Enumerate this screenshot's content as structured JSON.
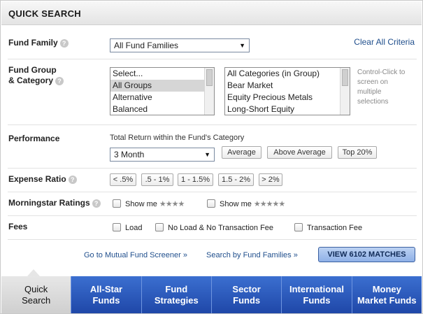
{
  "header": {
    "title": "QUICK SEARCH"
  },
  "fund_family": {
    "label": "Fund Family",
    "selected": "All Fund Families",
    "clear_link": "Clear All Criteria"
  },
  "fund_group": {
    "label_line1": "Fund Group",
    "label_line2": "& Category",
    "groups": [
      "Select...",
      "All Groups",
      "Alternative",
      "Balanced"
    ],
    "selected_group": "All Groups",
    "categories": [
      "All Categories (in Group)",
      "Bear Market",
      "Equity Precious Metals",
      "Long-Short Equity"
    ],
    "hint": "Control-Click to screen on multiple selections"
  },
  "performance": {
    "label": "Performance",
    "subtext": "Total Return within the Fund's Category",
    "selected": "3 Month",
    "buttons": [
      "Average",
      "Above Average",
      "Top 20%"
    ]
  },
  "expense_ratio": {
    "label": "Expense Ratio",
    "buttons": [
      "< .5%",
      ".5 - 1%",
      "1 - 1.5%",
      "1.5 - 2%",
      "> 2%"
    ]
  },
  "ratings": {
    "label": "Morningstar Ratings",
    "option1": {
      "text": "Show me",
      "stars": "★★★★"
    },
    "option2": {
      "text": "Show me",
      "stars": "★★★★★"
    }
  },
  "fees": {
    "label": "Fees",
    "options": [
      "Load",
      "No Load & No Transaction Fee",
      "Transaction Fee"
    ]
  },
  "footer": {
    "screener_link": "Go to Mutual Fund Screener »",
    "families_link": "Search by Fund Families »",
    "view_button": "VIEW 6102 MATCHES"
  },
  "tabs": [
    {
      "line1": "Quick",
      "line2": "Search"
    },
    {
      "line1": "All-Star",
      "line2": "Funds"
    },
    {
      "line1": "Fund",
      "line2": "Strategies"
    },
    {
      "line1": "Sector",
      "line2": "Funds"
    },
    {
      "line1": "International",
      "line2": "Funds"
    },
    {
      "line1": "Money",
      "line2": "Market Funds"
    }
  ],
  "colors": {
    "accent": "#2a56bf",
    "link": "#1f4e8c",
    "active_tab": "#dcdcdc"
  }
}
